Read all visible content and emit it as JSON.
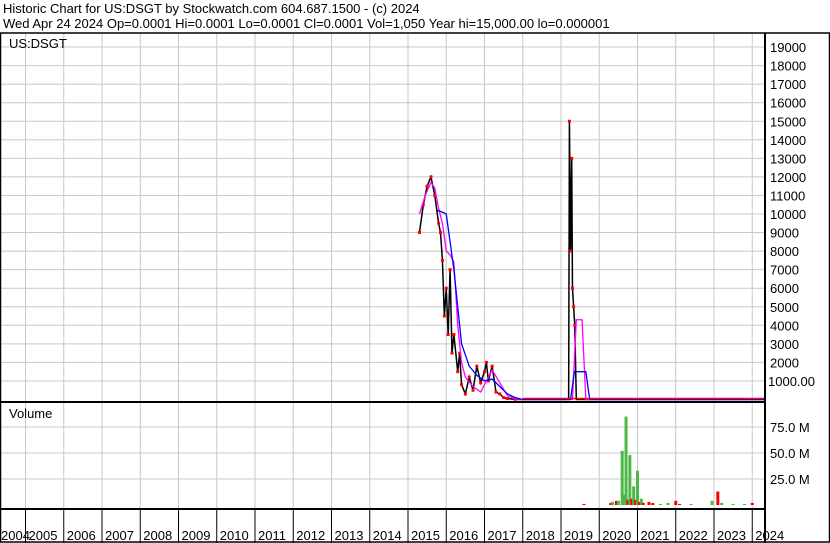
{
  "header": {
    "title": "Historic Chart for US:DSGT by Stockwatch.com 604.687.1500 - (c) 2024",
    "quote": "Wed Apr 24 2024   Op=0.0001   Hi=0.0001   Lo=0.0001   Cl=0.0001   Vol=1,050   Year hi=15,000.00   lo=0.000001"
  },
  "colors": {
    "price": "#000000",
    "up": "#ff0000",
    "ma_short": "#ff00ff",
    "ma_long": "#0000ff",
    "vol_up": "#4cb848",
    "vol_down": "#ff0000",
    "grid": "#c8c8c8"
  },
  "chart_data": [
    {
      "type": "line",
      "title": "US:DSGT",
      "x_ticks": [
        "2004",
        "2005",
        "2006",
        "2007",
        "2008",
        "2009",
        "2010",
        "2011",
        "2012",
        "2013",
        "2014",
        "2015",
        "2016",
        "2017",
        "2018",
        "2019",
        "2020",
        "2021",
        "2022",
        "2023",
        "2024"
      ],
      "y_ticks": [
        "1000.00",
        "2000",
        "3000",
        "4000",
        "5000",
        "6000",
        "7000",
        "8000",
        "9000",
        "10000",
        "11000",
        "12000",
        "13000",
        "14000",
        "15000",
        "16000",
        "17000",
        "18000",
        "19000"
      ],
      "ylim": [
        0,
        19500
      ],
      "series": [
        {
          "name": "price",
          "x": [
            2015.3,
            2015.4,
            2015.5,
            2015.6,
            2015.7,
            2015.8,
            2015.85,
            2015.9,
            2015.95,
            2016.0,
            2016.05,
            2016.1,
            2016.15,
            2016.2,
            2016.3,
            2016.35,
            2016.4,
            2016.5,
            2016.6,
            2016.7,
            2016.8,
            2016.9,
            2017.0,
            2017.05,
            2017.1,
            2017.2,
            2017.3,
            2017.4,
            2017.5,
            2017.6,
            2017.8,
            2018.0,
            2019.2,
            2019.22,
            2019.25,
            2019.28,
            2019.3,
            2019.33,
            2019.36,
            2019.4,
            2020.0,
            2024.3
          ],
          "values": [
            9000,
            10500,
            11500,
            12000,
            11000,
            9500,
            9000,
            7500,
            4500,
            6000,
            3500,
            7000,
            2500,
            3500,
            1500,
            2500,
            800,
            300,
            1200,
            500,
            1800,
            900,
            1500,
            2000,
            1000,
            1800,
            400,
            300,
            100,
            50,
            10,
            1,
            1,
            15000,
            8000,
            13000,
            6000,
            5000,
            4000,
            1,
            0.0001,
            0.0001
          ]
        },
        {
          "name": "ma_short",
          "x": [
            2015.3,
            2015.45,
            2015.6,
            2015.7,
            2015.8,
            2015.9,
            2016.0,
            2016.1,
            2016.2,
            2016.3,
            2016.4,
            2016.5,
            2016.7,
            2016.9,
            2017.1,
            2017.2,
            2017.4,
            2017.6,
            2017.8,
            2018.0,
            2019.3,
            2019.4,
            2019.55,
            2019.65,
            2019.75,
            2024.3
          ],
          "values": [
            10000,
            11000,
            11700,
            11400,
            10300,
            9500,
            8000,
            7800,
            7400,
            4000,
            2000,
            1200,
            700,
            400,
            1200,
            1600,
            900,
            200,
            30,
            0,
            0,
            4300,
            4300,
            0,
            0,
            0
          ]
        },
        {
          "name": "ma_long",
          "x": [
            2015.76,
            2015.9,
            2016.0,
            2016.1,
            2016.2,
            2016.3,
            2016.4,
            2016.6,
            2016.8,
            2017.0,
            2017.2,
            2017.4,
            2017.6,
            2017.8,
            2018.0,
            2019.25,
            2019.35,
            2019.65,
            2019.75,
            2024.3
          ],
          "values": [
            10200,
            10100,
            10000,
            8500,
            7000,
            5000,
            3000,
            1800,
            1300,
            1000,
            1100,
            700,
            300,
            100,
            0,
            0,
            1500,
            1500,
            0,
            0
          ]
        }
      ]
    },
    {
      "type": "bar",
      "title": "Volume",
      "y_ticks": [
        "25.0 M",
        "50.0 M",
        "75.0 M"
      ],
      "ylim": [
        0,
        100
      ],
      "unit": "M",
      "bars": [
        {
          "x": 2019.6,
          "v": 1,
          "c": "down"
        },
        {
          "x": 2020.3,
          "v": 2,
          "c": "down"
        },
        {
          "x": 2020.35,
          "v": 3,
          "c": "up"
        },
        {
          "x": 2020.45,
          "v": 4,
          "c": "down"
        },
        {
          "x": 2020.5,
          "v": 4,
          "c": "up"
        },
        {
          "x": 2020.6,
          "v": 52,
          "c": "up"
        },
        {
          "x": 2020.65,
          "v": 10,
          "c": "up"
        },
        {
          "x": 2020.7,
          "v": 85,
          "c": "up"
        },
        {
          "x": 2020.75,
          "v": 5,
          "c": "down"
        },
        {
          "x": 2020.8,
          "v": 48,
          "c": "up"
        },
        {
          "x": 2020.85,
          "v": 6,
          "c": "down"
        },
        {
          "x": 2020.9,
          "v": 18,
          "c": "up"
        },
        {
          "x": 2020.95,
          "v": 5,
          "c": "down"
        },
        {
          "x": 2021.0,
          "v": 33,
          "c": "up"
        },
        {
          "x": 2021.05,
          "v": 3,
          "c": "down"
        },
        {
          "x": 2021.1,
          "v": 6,
          "c": "up"
        },
        {
          "x": 2021.15,
          "v": 2,
          "c": "down"
        },
        {
          "x": 2021.3,
          "v": 3,
          "c": "down"
        },
        {
          "x": 2021.4,
          "v": 2,
          "c": "down"
        },
        {
          "x": 2021.6,
          "v": 1,
          "c": "up"
        },
        {
          "x": 2021.8,
          "v": 2,
          "c": "up"
        },
        {
          "x": 2022.0,
          "v": 4,
          "c": "down"
        },
        {
          "x": 2022.1,
          "v": 1,
          "c": "down"
        },
        {
          "x": 2022.4,
          "v": 1,
          "c": "up"
        },
        {
          "x": 2022.95,
          "v": 4,
          "c": "up"
        },
        {
          "x": 2023.1,
          "v": 13,
          "c": "down"
        },
        {
          "x": 2023.2,
          "v": 2,
          "c": "up"
        },
        {
          "x": 2023.5,
          "v": 1,
          "c": "up"
        },
        {
          "x": 2023.8,
          "v": 1,
          "c": "up"
        },
        {
          "x": 2024.0,
          "v": 2,
          "c": "down"
        }
      ]
    }
  ]
}
